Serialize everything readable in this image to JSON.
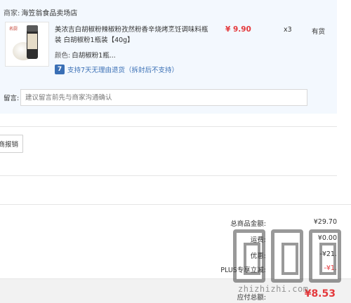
{
  "store": {
    "label": "商家:",
    "name": "海笠翁食品卖场店"
  },
  "product": {
    "logo_text": "名厨",
    "title": "美浓吉白胡椒粉辣椒粉孜然粉香辛烧烤烹饪调味料瓶装 白胡椒粉1瓶装【40g】",
    "attr_label": "颜色:",
    "attr_value": "白胡椒粉1瓶...",
    "service_badge": "7",
    "service_text": "支持7天无理由退货（拆封后不支持）",
    "price": "¥ 9.90",
    "quantity": "x3",
    "stock_status": "有货"
  },
  "remark": {
    "label": "留言:",
    "placeholder": "建议留言前先与商家沟通确认"
  },
  "report_button": "商报销",
  "summary": {
    "total_label": "总商品金额:",
    "total_value": "¥29.70",
    "freight_label": "运费:",
    "freight_value": "¥0.00",
    "discount_label": "优惠:",
    "discount_value": "-¥21.",
    "plus_label": "PLUS专享立减:",
    "plus_value": "-¥1.",
    "payable_label": "应付总额:",
    "payable_value": "¥8.53"
  },
  "watermark": {
    "text": "zhizhizhi.com"
  },
  "colors": {
    "price_red": "#e4393c",
    "panel_bg": "#f3f8fe",
    "service_blue": "#3a6fb5"
  }
}
